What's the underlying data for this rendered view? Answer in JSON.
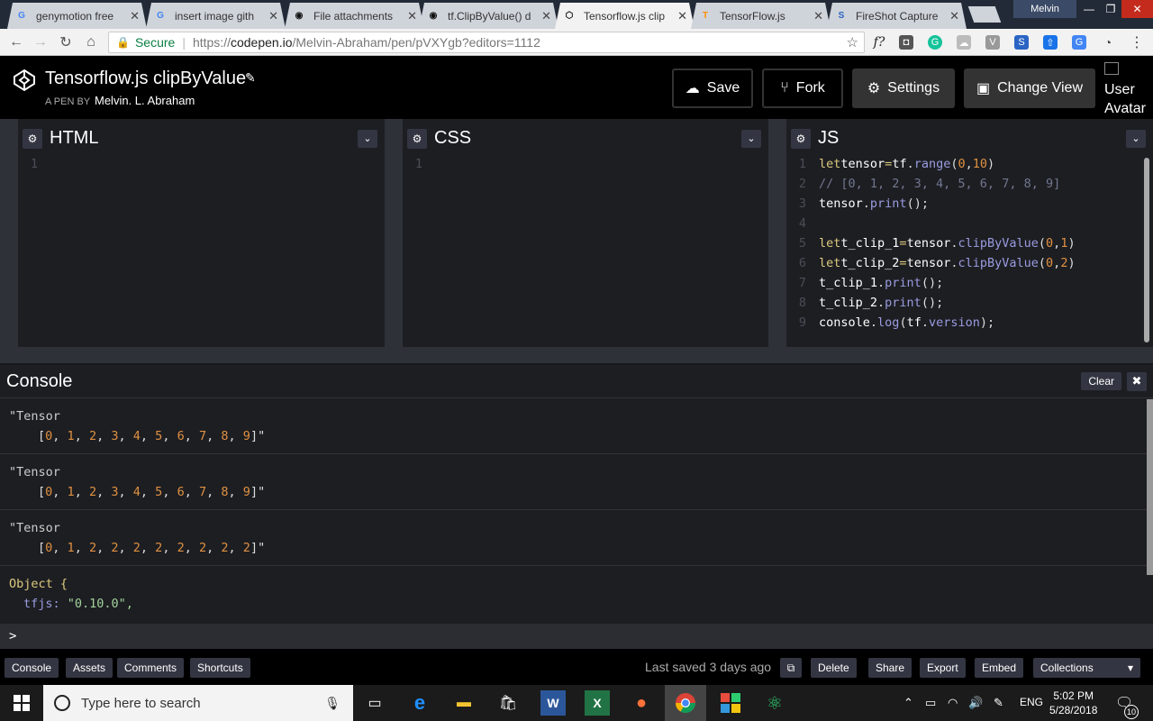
{
  "browser": {
    "tabs": [
      {
        "title": "genymotion free",
        "icon": "google-icon",
        "color": "#4285f4",
        "glyph": "G"
      },
      {
        "title": "insert image gith",
        "icon": "google-icon",
        "color": "#4285f4",
        "glyph": "G"
      },
      {
        "title": "File attachments",
        "icon": "github-icon",
        "color": "#111111",
        "glyph": "◉"
      },
      {
        "title": "tf.ClipByValue() d",
        "icon": "github-icon",
        "color": "#111111",
        "glyph": "◉"
      },
      {
        "title": "Tensorflow.js clip",
        "icon": "codepen-icon",
        "color": "#111111",
        "glyph": "⬡"
      },
      {
        "title": "TensorFlow.js",
        "icon": "tensorflow-icon",
        "color": "#ff8f00",
        "glyph": "T"
      },
      {
        "title": "FireShot Capture",
        "icon": "fireshot-icon",
        "color": "#2a64c4",
        "glyph": "S"
      }
    ],
    "close_glyph": "✕",
    "profile_name": "Melvin",
    "win_minimize": "—",
    "win_restore": "❐",
    "win_close": "✕",
    "address": {
      "secure_label": "Secure",
      "scheme": "https://",
      "host": "codepen.io",
      "path": "/Melvin-Abraham/pen/pVXYgb?editors=1112"
    }
  },
  "header": {
    "title": "Tensorflow.js clipByValue",
    "pen_by_label": "A PEN BY",
    "author": "Melvin. L. Abraham",
    "buttons": {
      "save": "Save",
      "fork": "Fork",
      "settings": "Settings",
      "change_view": "Change View"
    },
    "avatar_alt_line1": "User",
    "avatar_alt_line2": "Avatar"
  },
  "editors": {
    "html": {
      "title": "HTML",
      "line_number": "1"
    },
    "css": {
      "title": "CSS",
      "line_number": "1"
    },
    "js": {
      "title": "JS"
    }
  },
  "console": {
    "title": "Console",
    "clear_label": "Clear",
    "entries": [
      {
        "line1": "\"Tensor",
        "line2": "[0, 1, 2, 3, 4, 5, 6, 7, 8, 9]\""
      },
      {
        "line1": "\"Tensor",
        "line2": "[0, 1, 2, 3, 4, 5, 6, 7, 8, 9]\""
      },
      {
        "line1": "\"Tensor",
        "line2": "[0, 1, 2, 2, 2, 2, 2, 2, 2, 2]\""
      }
    ],
    "object_line1": "Object {",
    "object_key": "tfjs:",
    "object_value": "\"0.10.0\",",
    "prompt": ">"
  },
  "footer": {
    "tabs": [
      "Console",
      "Assets",
      "Comments",
      "Shortcuts"
    ],
    "last_saved": "Last saved 3 days ago",
    "actions": [
      "Delete",
      "Share",
      "Export",
      "Embed"
    ],
    "collections": "Collections"
  },
  "taskbar": {
    "search_placeholder": "Type here to search",
    "language": "ENG",
    "time": "5:02 PM",
    "date": "5/28/2018",
    "notification_count": "10"
  }
}
